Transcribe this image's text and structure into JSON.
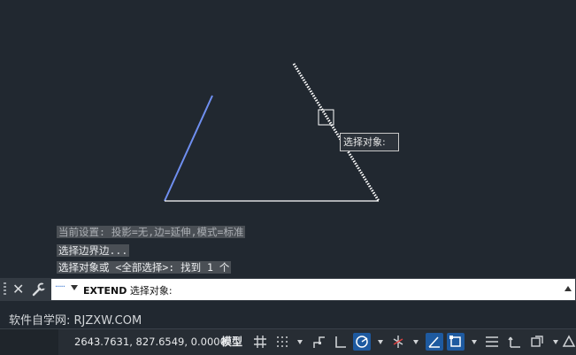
{
  "canvas": {
    "tooltip_label": "选择对象:",
    "colors": {
      "background": "#212830",
      "line_white": "#ffffff",
      "line_blue": "#6f8ff0",
      "selected_line": "#ffffff"
    }
  },
  "command_history": [
    "当前设置: 投影=无,边=延伸,模式=标准",
    "选择边界边...",
    "选择对象或 <全部选择>: 找到 1 个"
  ],
  "command_line": {
    "command": "EXTEND",
    "prompt": "选择对象:"
  },
  "watermark": "软件自学网: RJZXW.COM",
  "status_bar": {
    "coordinates": "2643.7631, 827.6549, 0.0000",
    "model_label": "模型",
    "icons": [
      "grid-icon",
      "snap-icon",
      "infer-constraints-icon",
      "ortho-icon",
      "polar-tracking-icon",
      "isodraft-icon",
      "object-snap-tracking-icon",
      "object-snap-icon",
      "lineweight-icon",
      "ucs-icon",
      "selection-cycling-icon",
      "annotation-icon"
    ]
  }
}
